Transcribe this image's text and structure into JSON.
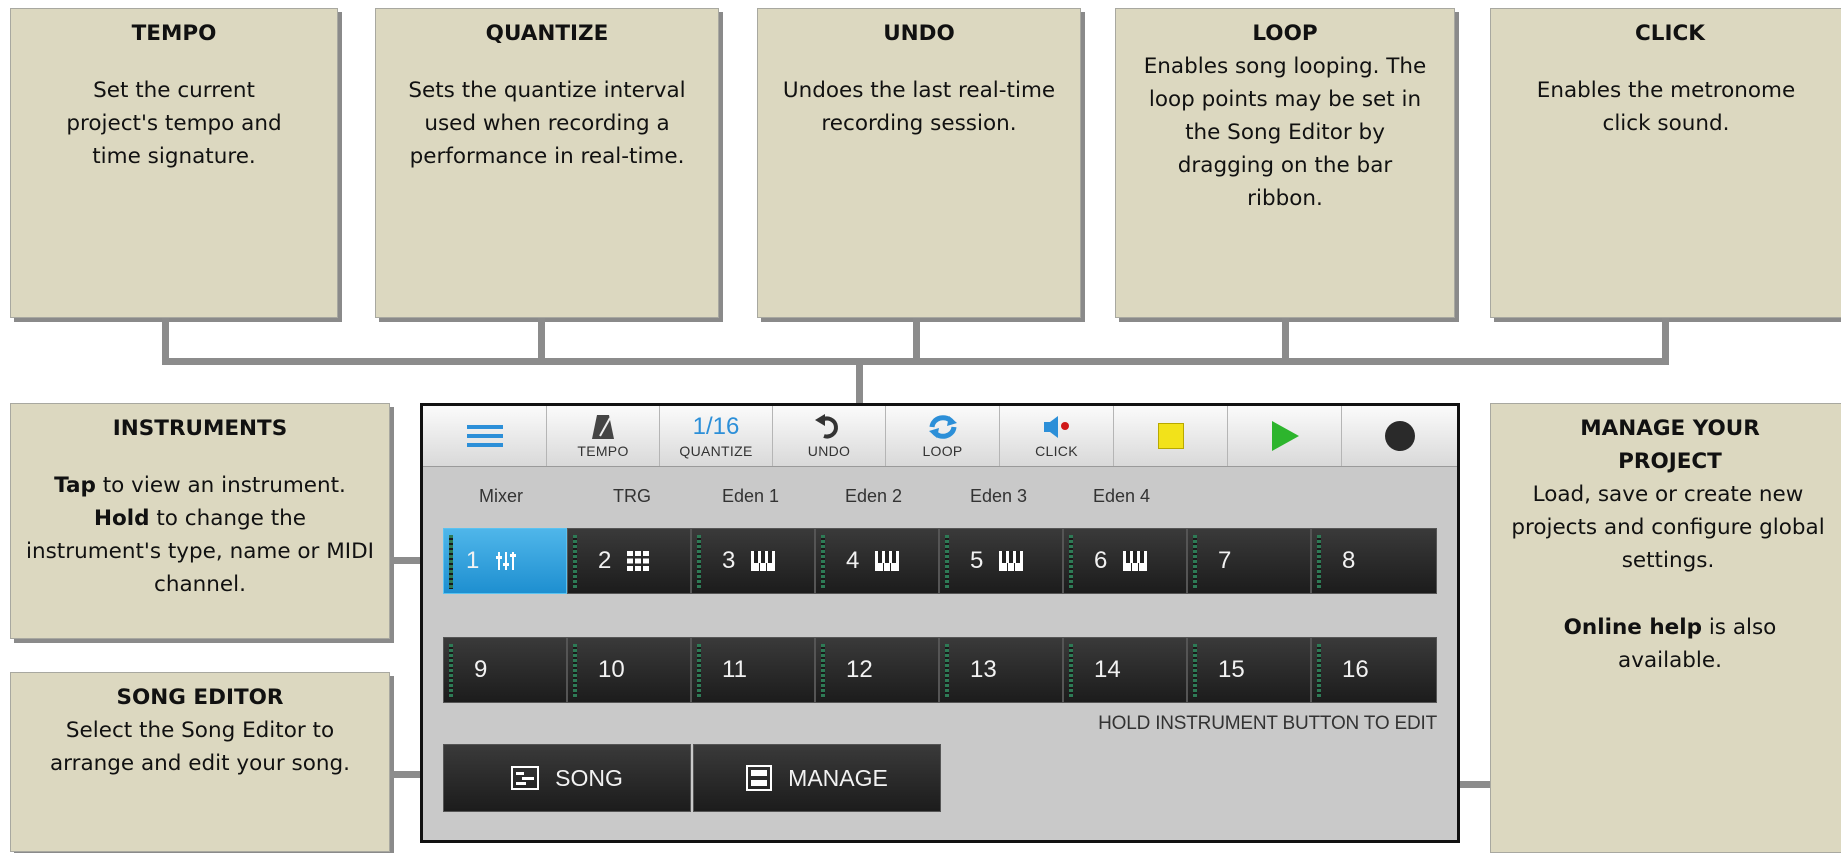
{
  "callouts": {
    "tempo": {
      "title": "TEMPO",
      "text": "Set the current project's tempo and time signature."
    },
    "quantize": {
      "title": "QUANTIZE",
      "text": "Sets the quantize interval used when recording a performance in real-time."
    },
    "undo": {
      "title": "UNDO",
      "text": "Undoes the last real-time recording session."
    },
    "loop": {
      "title": "LOOP",
      "text": "Enables song looping. The loop points may be set in the Song Editor by dragging on the bar ribbon."
    },
    "click": {
      "title": "CLICK",
      "text": "Enables the metronome click sound."
    },
    "instruments": {
      "title": "INSTRUMENTS",
      "tap_bold": "Tap",
      "tap_text": " to view an instrument.",
      "hold_bold": "Hold",
      "hold_text": " to change the instrument's type, name or MIDI channel."
    },
    "song_editor": {
      "title": "SONG EDITOR",
      "text": "Select the Song Editor to arrange and edit your song."
    },
    "manage": {
      "title": "MANAGE YOUR PROJECT",
      "text": "Load, save or create new projects and configure global settings.",
      "help_bold": "Online help",
      "help_text": " is also available."
    }
  },
  "toolbar": {
    "tempo_label": "TEMPO",
    "quantize_value": "1/16",
    "quantize_label": "QUANTIZE",
    "undo_label": "UNDO",
    "loop_label": "LOOP",
    "click_label": "CLICK"
  },
  "instrument_names": [
    "Mixer",
    "TRG",
    "Eden 1",
    "Eden 2",
    "Eden 3",
    "Eden 4"
  ],
  "instrument_buttons": {
    "row1": [
      "1",
      "2",
      "3",
      "4",
      "5",
      "6",
      "7",
      "8"
    ],
    "row2": [
      "9",
      "10",
      "11",
      "12",
      "13",
      "14",
      "15",
      "16"
    ]
  },
  "hold_hint": "HOLD INSTRUMENT BUTTON TO EDIT",
  "bottom_buttons": {
    "song": "SONG",
    "manage": "MANAGE"
  },
  "colors": {
    "callout_bg": "#dcd8c0",
    "connector": "#8c8c8c",
    "selected": "#1e8fd0",
    "accent_blue": "#2c8fd8",
    "play_green": "#2db52d",
    "stop_yellow": "#f2e21a"
  },
  "icons": {
    "menu": "hamburger-menu-icon",
    "tempo": "metronome-icon",
    "undo": "undo-arrow-icon",
    "loop": "loop-arrows-icon",
    "click": "speaker-icon",
    "stop": "stop-square-icon",
    "play": "play-triangle-icon",
    "record": "record-circle-icon",
    "mixer": "mixer-sliders-icon",
    "drum": "drum-grid-icon",
    "keys": "piano-keys-icon",
    "song": "song-editor-icon",
    "manage": "manage-project-icon"
  }
}
